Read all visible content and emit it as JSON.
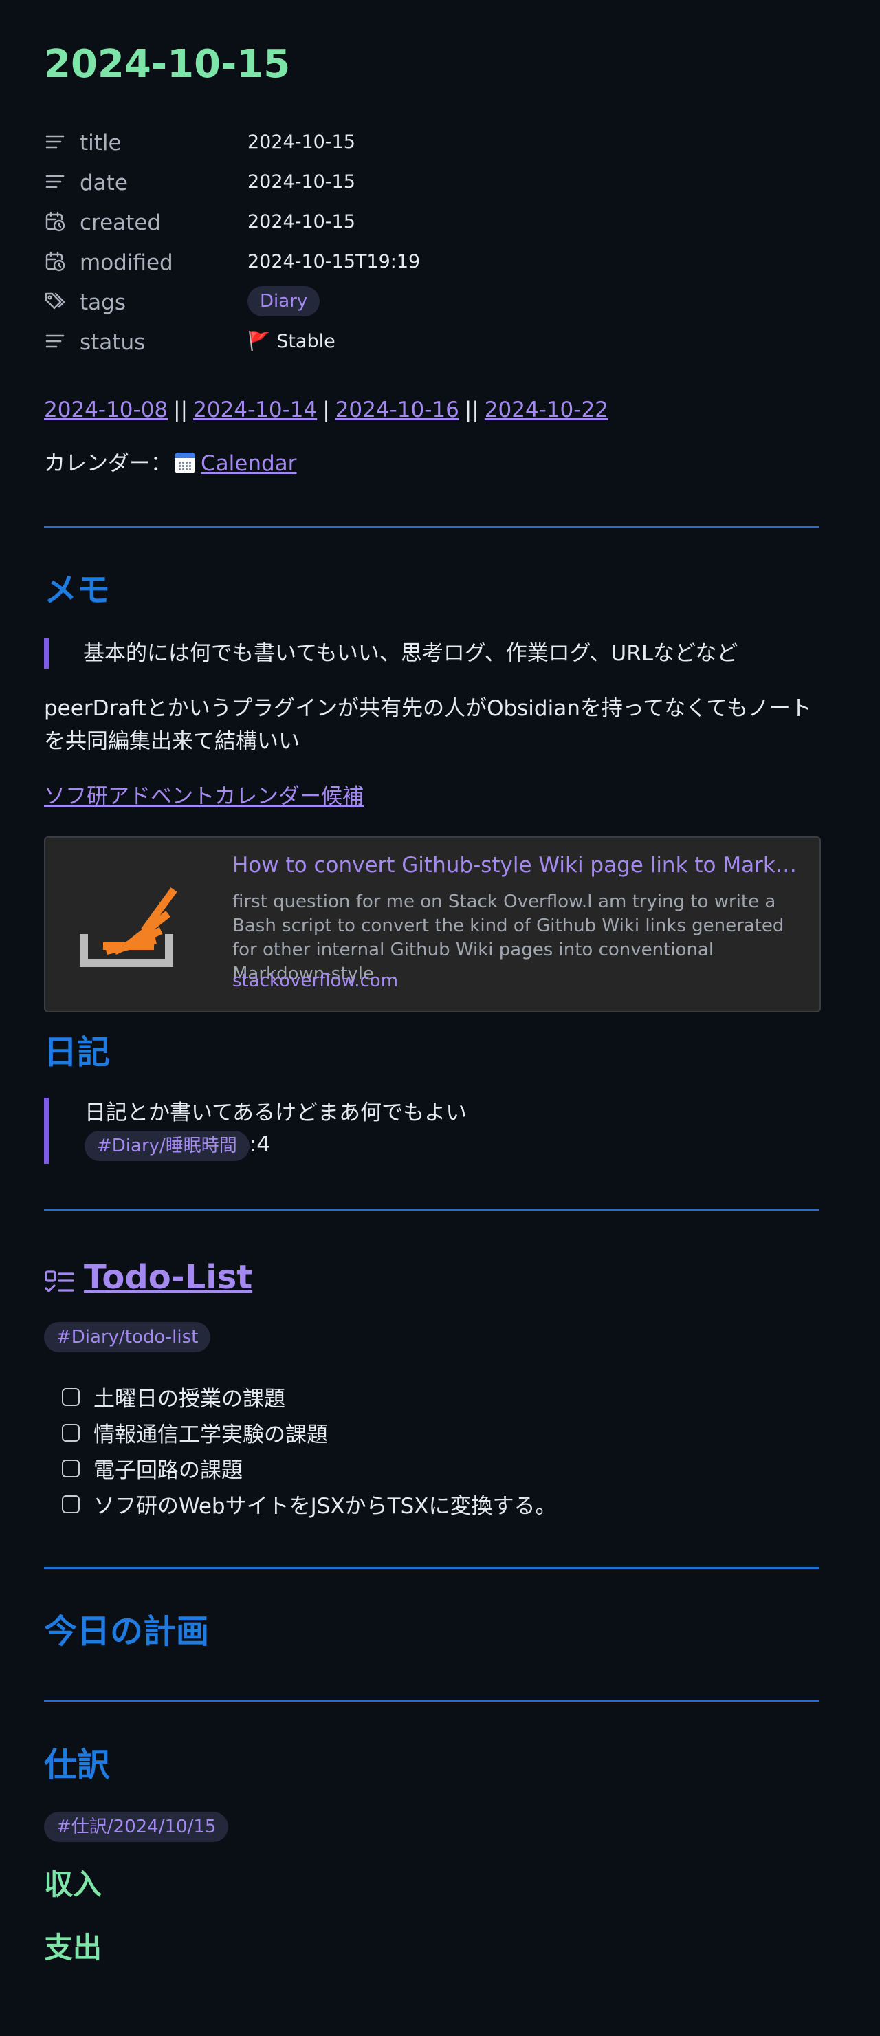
{
  "note": {
    "title": "2024-10-15",
    "properties": [
      {
        "icon": "text-lines-icon",
        "name": "title",
        "value": "2024-10-15"
      },
      {
        "icon": "text-lines-icon",
        "name": "date",
        "value": "2024-10-15"
      },
      {
        "icon": "calendar-clock-icon",
        "name": "created",
        "value": "2024-10-15"
      },
      {
        "icon": "calendar-clock-icon",
        "name": "modified",
        "value": "2024-10-15T19:19"
      },
      {
        "icon": "tags-icon",
        "name": "tags",
        "value": "Diary"
      },
      {
        "icon": "text-lines-icon",
        "name": "status",
        "value": "🚩 Stable"
      }
    ],
    "nav": {
      "prev_week": "2024-10-08",
      "sep1": "||",
      "prev_day": "2024-10-14",
      "sep2": "|",
      "next_day": "2024-10-16",
      "sep3": "||",
      "next_week": "2024-10-22"
    },
    "calendar": {
      "label": "カレンダー：",
      "icon": "calendar-icon",
      "link": "Calendar"
    }
  },
  "memo": {
    "heading": "メモ",
    "quote": "基本的には何でも書いてもいい、思考ログ、作業ログ、URLなどなど",
    "paragraph": "peerDraftとかいうプラグインが共有先の人がObsidianを持ってなくてもノートを共同編集出来て結構いい",
    "link": "ソフ研アドベントカレンダー候補",
    "card": {
      "icon": "stackoverflow-logo",
      "title": "How to convert Github-style Wiki page link to Markdown-style link",
      "description": "first question for me on Stack Overflow.I am trying to write a Bash script to convert the kind of Github Wiki links generated for other internal Github Wiki pages into conventional Markdown-style ...",
      "url": "stackoverflow.com"
    }
  },
  "diary": {
    "heading": "日記",
    "quote_line": "日記とか書いてあるけどまあ何でもよい",
    "tag": "#Diary/睡眠時間",
    "tag_suffix": ":4"
  },
  "todo": {
    "icon": "checklist-icon",
    "heading": "Todo-List",
    "tag": "#Diary/todo-list",
    "items": [
      {
        "label": "土曜日の授業の課題",
        "checked": false
      },
      {
        "label": "情報通信工学実験の課題",
        "checked": false
      },
      {
        "label": "電子回路の課題",
        "checked": false
      },
      {
        "label": "ソフ研のWebサイトをJSXからTSXに変換する。",
        "checked": false
      }
    ]
  },
  "plan": {
    "heading": "今日の計画"
  },
  "journal": {
    "heading": "仕訳",
    "tag": "#仕訳/2024/10/15",
    "income": "収入",
    "expense": "支出"
  },
  "colors": {
    "background": "#0a0e15",
    "title_green": "#7ee5a8",
    "heading_blue": "#1f7be0",
    "link_purple": "#a48af0",
    "divider_blue": "#1f6fd6",
    "quote_bar": "#7c5ce8"
  }
}
